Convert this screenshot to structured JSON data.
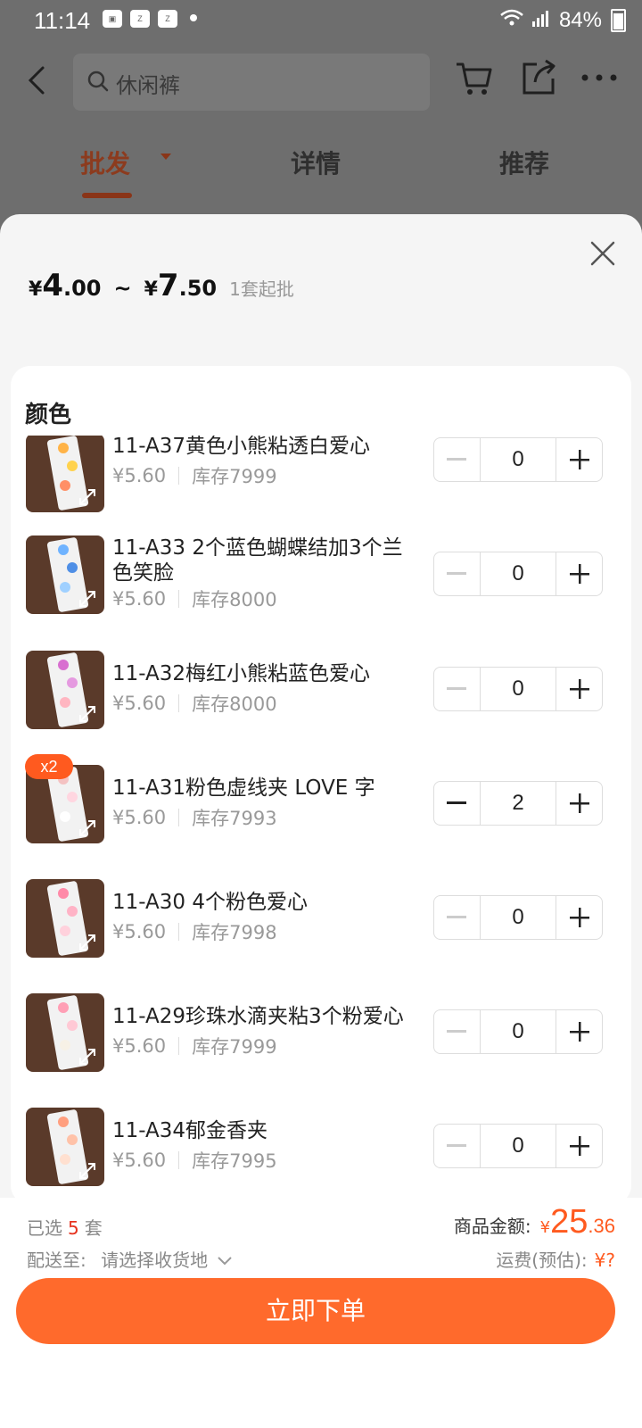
{
  "status_bar": {
    "time": "11:14",
    "battery": "84%"
  },
  "header": {
    "search_placeholder": "休闲裤",
    "tabs": [
      {
        "label": "批发",
        "active": true
      },
      {
        "label": "详情",
        "active": false
      },
      {
        "label": "推荐",
        "active": false
      }
    ]
  },
  "sheet": {
    "price": {
      "cur1": "¥",
      "min_int": "4",
      "min_dec": ".00",
      "tilde": "~",
      "cur2": "¥",
      "max_int": "7",
      "max_dec": ".50",
      "moq": "1套起批"
    },
    "section_title": "颜色",
    "items": [
      {
        "name": "11-A37黄色小熊粘透白爱心",
        "price": "¥5.60",
        "stock": "库存7999",
        "qty": "0",
        "colors": [
          "#ffb347",
          "#ffd24d",
          "#ff8f66"
        ]
      },
      {
        "name": "11-A33  2个蓝色蝴蝶结加3个兰色笑脸",
        "price": "¥5.60",
        "stock": "库存8000",
        "qty": "0",
        "colors": [
          "#6fb3ff",
          "#4f8fe6",
          "#9fd0ff"
        ]
      },
      {
        "name": "11-A32梅红小熊粘蓝色爱心",
        "price": "¥5.60",
        "stock": "库存8000",
        "qty": "0",
        "colors": [
          "#d86fd0",
          "#e59ae0",
          "#ffb6c1"
        ]
      },
      {
        "name": "11-A31粉色虚线夹 LOVE 字",
        "price": "¥5.60",
        "stock": "库存7993",
        "qty": "2",
        "badge": "x2",
        "colors": [
          "#f4c2c2",
          "#ffd6e0",
          "#ffffff"
        ]
      },
      {
        "name": "11-A30  4个粉色爱心",
        "price": "¥5.60",
        "stock": "库存7998",
        "qty": "0",
        "colors": [
          "#ff8aa8",
          "#ffb3c6",
          "#ffd1dc"
        ]
      },
      {
        "name": "11-A29珍珠水滴夹粘3个粉爱心",
        "price": "¥5.60",
        "stock": "库存7999",
        "qty": "0",
        "colors": [
          "#ff9fb5",
          "#ffc9d5",
          "#f7f1e6"
        ]
      },
      {
        "name": "11-A34郁金香夹",
        "price": "¥5.60",
        "stock": "库存7995",
        "qty": "0",
        "colors": [
          "#ff9f7f",
          "#ffc2a8",
          "#ffe0d0"
        ]
      }
    ]
  },
  "footer": {
    "selected_prefix": "已选",
    "selected_count": "5",
    "selected_unit": "套",
    "ship_label": "配送至:",
    "ship_value": "请选择收货地",
    "goods_label": "商品金额:",
    "goods_cur": "¥",
    "goods_int": "25",
    "goods_dec": ".36",
    "freight_label": "运费(预估):",
    "freight_value": "¥?",
    "order_button": "立即下单"
  },
  "colors": {
    "accent": "#ff6a2c",
    "price_red": "#ff5a1f",
    "badge": "#ff5a1f"
  }
}
